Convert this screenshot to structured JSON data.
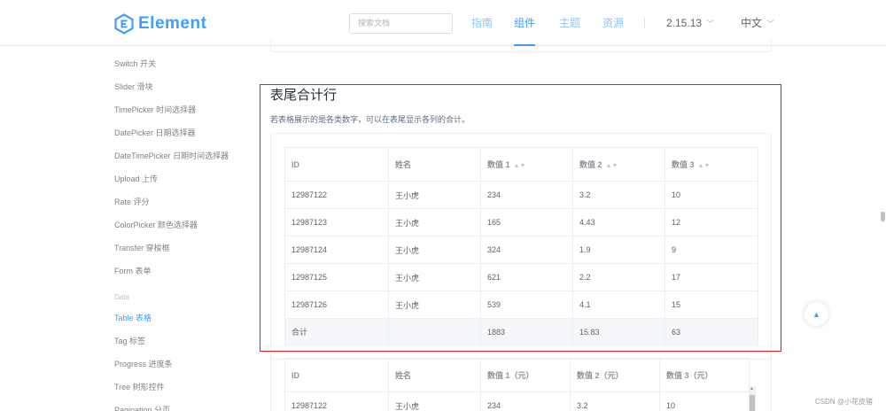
{
  "header": {
    "logo_text": "Element",
    "search_placeholder": "搜索文档",
    "nav": [
      {
        "label": "指南",
        "active": false
      },
      {
        "label": "组件",
        "active": true
      },
      {
        "label": "主题",
        "active": false
      },
      {
        "label": "资源",
        "active": false
      }
    ],
    "version": "2.15.13",
    "language": "中文"
  },
  "sidebar": {
    "items": [
      {
        "label": "Switch 开关"
      },
      {
        "label": "Slider 滑块"
      },
      {
        "label": "TimePicker 时间选择器"
      },
      {
        "label": "DatePicker 日期选择器"
      },
      {
        "label": "DateTimePicker 日期时间选择器"
      },
      {
        "label": "Upload 上传"
      },
      {
        "label": "Rate 评分"
      },
      {
        "label": "ColorPicker 颜色选择器"
      },
      {
        "label": "Transfer 穿梭框"
      },
      {
        "label": "Form 表单"
      }
    ],
    "group_label": "Data",
    "data_items": [
      {
        "label": "Table 表格",
        "active": true
      },
      {
        "label": "Tag 标签"
      },
      {
        "label": "Progress 进度条"
      },
      {
        "label": "Tree 树形控件"
      },
      {
        "label": "Pagination 分页"
      }
    ]
  },
  "section": {
    "title": "表尾合计行",
    "description": "若表格展示的是各类数字，可以在表尾显示各列的合计。"
  },
  "table1": {
    "headers": [
      "ID",
      "姓名",
      "数值 1",
      "数值 2",
      "数值 3"
    ],
    "rows": [
      [
        "12987122",
        "王小虎",
        "234",
        "3.2",
        "10"
      ],
      [
        "12987123",
        "王小虎",
        "165",
        "4.43",
        "12"
      ],
      [
        "12987124",
        "王小虎",
        "324",
        "1.9",
        "9"
      ],
      [
        "12987125",
        "王小虎",
        "621",
        "2.2",
        "17"
      ],
      [
        "12987126",
        "王小虎",
        "539",
        "4.1",
        "15"
      ]
    ],
    "footer": [
      "合计",
      "",
      "1883",
      "15.83",
      "63"
    ]
  },
  "table2": {
    "headers": [
      "ID",
      "姓名",
      "数值 1（元）",
      "数值 2（元）",
      "数值 3（元）"
    ],
    "rows": [
      [
        "12987122",
        "王小虎",
        "234",
        "3.2",
        "10"
      ]
    ]
  },
  "watermark": "CSDN @小花皮猪",
  "colors": {
    "brand": "#409eff",
    "highlight_box": "#e02020",
    "footer_bg": "#f5f7fa"
  }
}
